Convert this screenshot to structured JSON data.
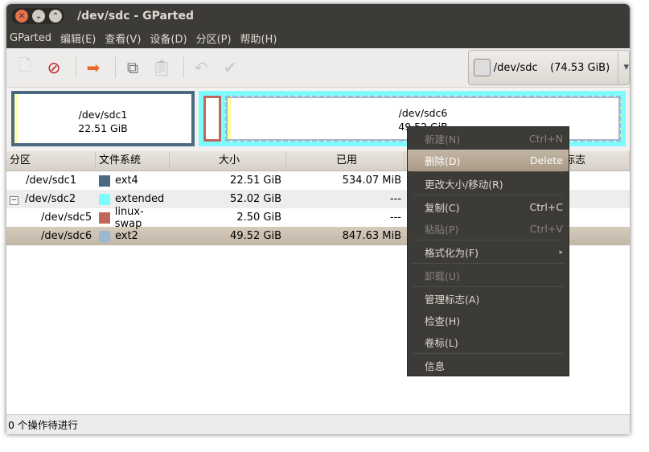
{
  "window": {
    "title": "/dev/sdc - GParted"
  },
  "menubar": [
    "GParted",
    "编辑(E)",
    "查看(V)",
    "设备(D)",
    "分区(P)",
    "帮助(H)"
  ],
  "device": {
    "name": "/dev/sdc",
    "size": "(74.53 GiB)"
  },
  "map": {
    "sdc1": {
      "name": "/dev/sdc1",
      "size": "22.51 GiB"
    },
    "sdc6": {
      "name": "/dev/sdc6",
      "size": "49.52 GiB"
    }
  },
  "columns": [
    "分区",
    "文件系统",
    "大小",
    "已用",
    "标志"
  ],
  "rows": [
    {
      "partition": "/dev/sdc1",
      "fs": "ext4",
      "color": "#4b6983",
      "size": "22.51 GiB",
      "used": "534.07 MiB"
    },
    {
      "partition": "/dev/sdc2",
      "fs": "extended",
      "color": "#7dfcfe",
      "size": "52.02 GiB",
      "used": "---"
    },
    {
      "partition": "/dev/sdc5",
      "fs": "linux-swap",
      "color": "#c1665a",
      "size": "2.50 GiB",
      "used": "---"
    },
    {
      "partition": "/dev/sdc6",
      "fs": "ext2",
      "color": "#9db8d2",
      "size": "49.52 GiB",
      "used": "847.63 MiB"
    }
  ],
  "context_menu": [
    {
      "label": "新建(N)",
      "shortcut": "Ctrl+N"
    },
    {
      "label": "删除(D)",
      "shortcut": "Delete"
    },
    {
      "label": "更改大小/移动(R)",
      "shortcut": ""
    },
    {
      "label": "复制(C)",
      "shortcut": "Ctrl+C"
    },
    {
      "label": "粘贴(P)",
      "shortcut": "Ctrl+V"
    },
    {
      "label": "格式化为(F)",
      "shortcut": "▸"
    },
    {
      "label": "卸载(U)",
      "shortcut": ""
    },
    {
      "label": "管理标志(A)",
      "shortcut": ""
    },
    {
      "label": "检查(H)",
      "shortcut": ""
    },
    {
      "label": "卷标(L)",
      "shortcut": ""
    },
    {
      "label": "信息",
      "shortcut": ""
    }
  ],
  "status": "0 个操作待进行"
}
